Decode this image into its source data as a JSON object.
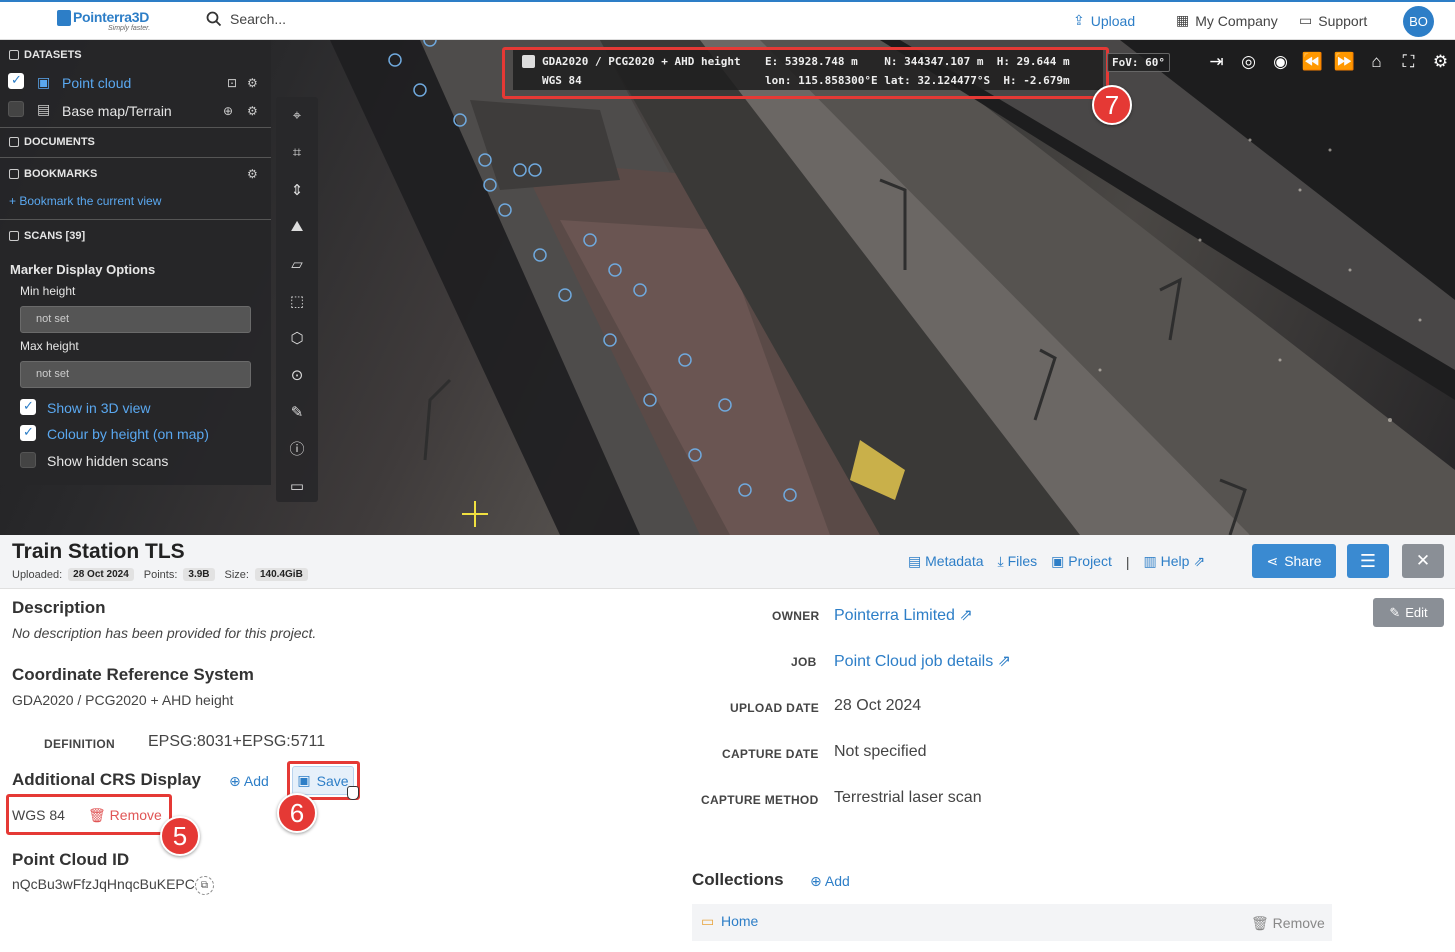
{
  "topbar": {
    "brand_name": "Pointerra3D",
    "brand_tagline": "Simply faster.",
    "search_placeholder": "Search...",
    "upload_label": "Upload",
    "company_label": "My Company",
    "support_label": "Support",
    "avatar_initials": "BO",
    "accent_color": "#2d7ec7"
  },
  "left_panel": {
    "datasets_title": "DATASETS",
    "datasets": [
      {
        "label": "Point cloud",
        "checked": true
      },
      {
        "label": "Base map/Terrain",
        "checked": false
      }
    ],
    "documents_title": "DOCUMENTS",
    "bookmarks_title": "BOOKMARKS",
    "bookmark_action": "+ Bookmark the current view",
    "scans_title": "SCANS [39]",
    "marker_options_title": "Marker Display Options",
    "min_height_label": "Min height",
    "min_height_value": "not set",
    "max_height_label": "Max height",
    "max_height_value": "not set",
    "options": [
      {
        "label": "Show in 3D view",
        "checked": true
      },
      {
        "label": "Colour by height (on map)",
        "checked": true
      },
      {
        "label": "Show hidden scans",
        "checked": false
      }
    ]
  },
  "viewer": {
    "crs_line_1_name": "GDA2020 / PCG2020 + AHD height",
    "crs_line_1_values": "E: 53928.748 m    N: 344347.107 m  H: 29.644 m",
    "crs_line_2_name": "WGS 84",
    "crs_line_2_values": "lon: 115.858300°E lat: 32.124477°S  H: -2.679m",
    "fov": "FoV: 60°",
    "callout_7": "7"
  },
  "project": {
    "title": "Train Station TLS",
    "uploaded_label": "Uploaded:",
    "uploaded_value": "28 Oct 2024",
    "points_label": "Points:",
    "points_value": "3.9B",
    "size_label": "Size:",
    "size_value": "140.4GiB",
    "link_metadata": "Metadata",
    "link_files": "Files",
    "link_project": "Project",
    "separator": "|",
    "link_help": "Help",
    "share_label": "Share"
  },
  "details": {
    "description_title": "Description",
    "description_text": "No description has been provided for this project.",
    "crs_title": "Coordinate Reference System",
    "crs_value": "GDA2020 / PCG2020 + AHD height",
    "definition_label": "DEFINITION",
    "definition_value": "EPSG:8031+EPSG:5711",
    "additional_crs_title": "Additional CRS Display",
    "add_label": "Add",
    "save_label": "Save",
    "additional_crs_item": "WGS 84",
    "remove_label": "Remove",
    "callout_5": "5",
    "callout_6": "6",
    "point_cloud_id_title": "Point Cloud ID",
    "point_cloud_id": "nQcBu3wFfzJqHnqcBuKEPC",
    "owner_label": "OWNER",
    "owner_value": "Pointerra Limited",
    "job_label": "JOB",
    "job_value": "Point Cloud job details",
    "upload_date_label": "UPLOAD DATE",
    "upload_date_value": "28 Oct 2024",
    "capture_date_label": "CAPTURE DATE",
    "capture_date_value": "Not specified",
    "capture_method_label": "CAPTURE METHOD",
    "capture_method_value": "Terrestrial laser scan",
    "edit_label": "Edit",
    "collections_title": "Collections",
    "collections_add": "Add",
    "collection_item": "Home",
    "collection_remove": "Remove"
  }
}
